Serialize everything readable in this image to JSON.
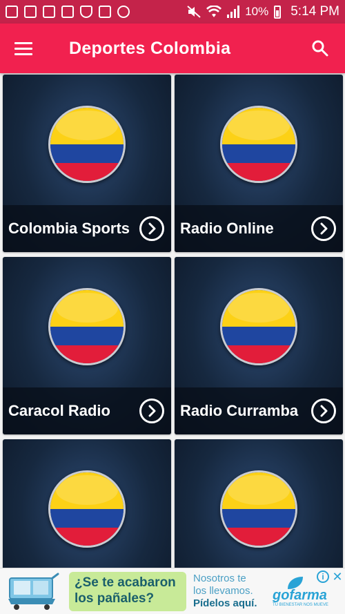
{
  "status_bar": {
    "battery": "10%",
    "time": "5:14 PM"
  },
  "app_bar": {
    "title": "Deportes Colombia"
  },
  "stations": [
    {
      "label": "Colombia Sports"
    },
    {
      "label": "Radio Online"
    },
    {
      "label": "Caracol Radio"
    },
    {
      "label": "Radio Curramba"
    },
    {
      "label": ""
    },
    {
      "label": ""
    }
  ],
  "ad": {
    "headline_line1": "¿Se te acabaron",
    "headline_line2": "los pañales?",
    "message_line1": "Nosotros te",
    "message_line2": "los llevamos.",
    "message_line3": "Pídelos aquí.",
    "brand": "gofarma",
    "brand_tagline": "TU BIENESTAR NOS MUEVE",
    "cart_brand": "gofarma"
  },
  "colors": {
    "status_bar": "#c4234a",
    "app_bar": "#f1214f",
    "flag_yellow": "#fcd116",
    "flag_blue": "#1f46a0",
    "flag_red": "#e21d3a"
  }
}
